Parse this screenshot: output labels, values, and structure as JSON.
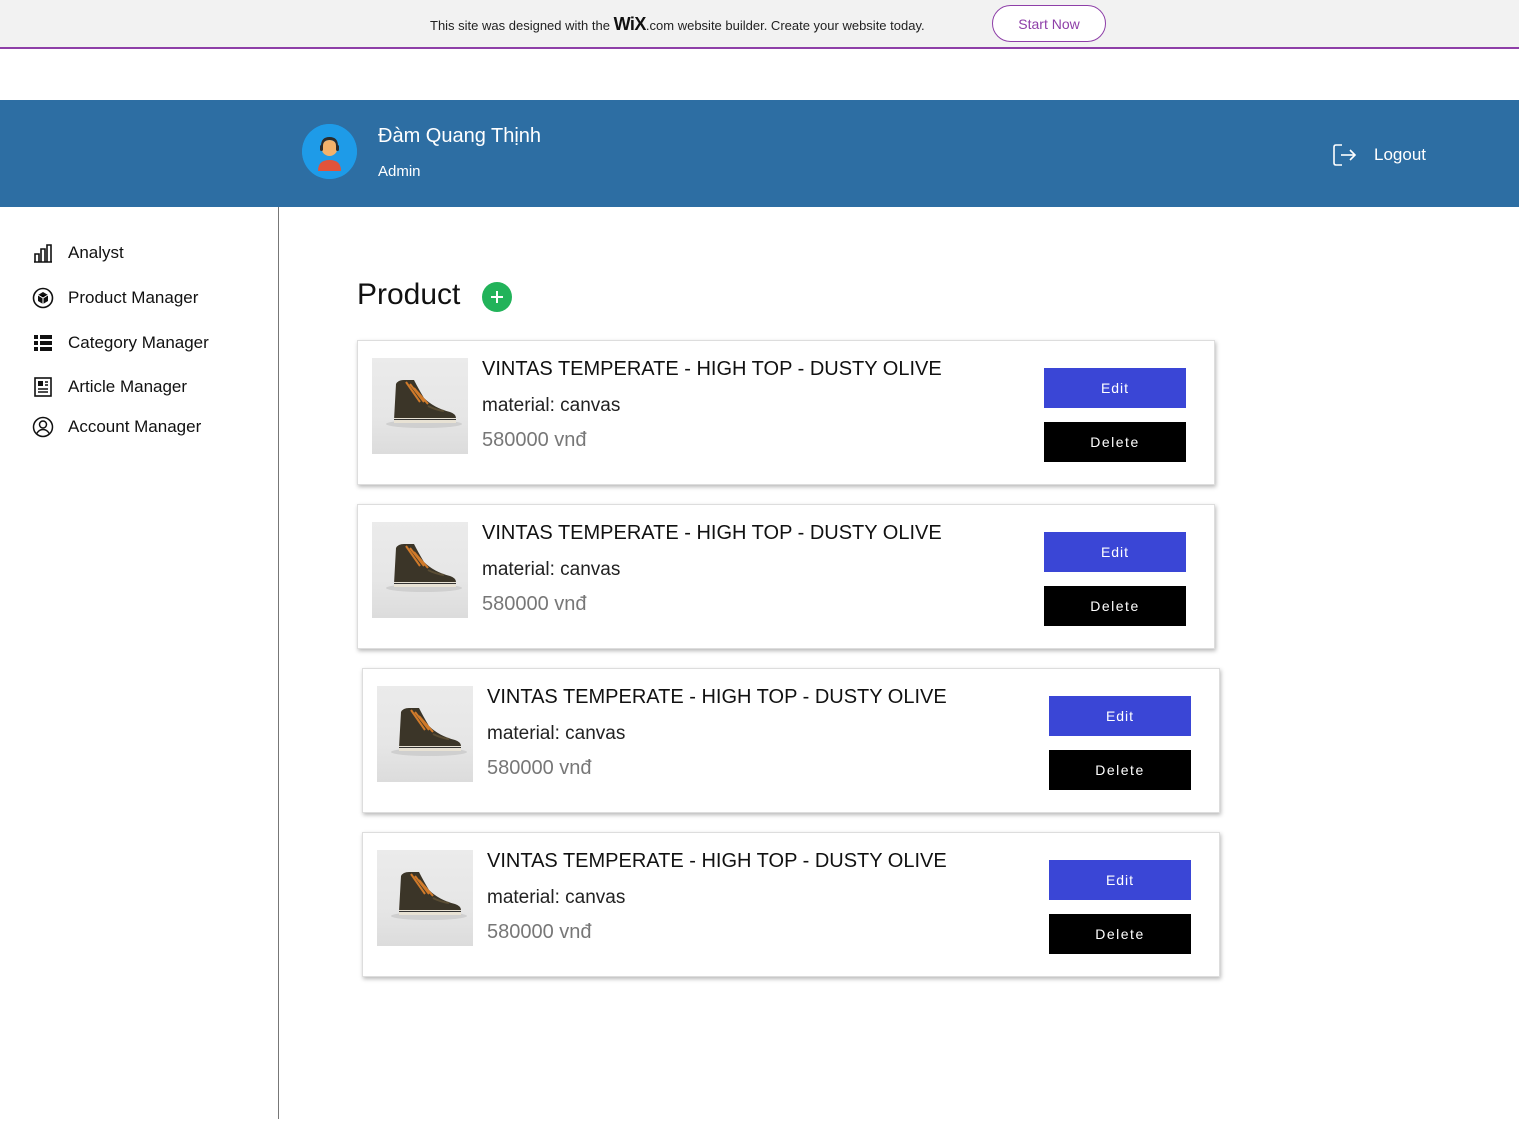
{
  "wix_banner": {
    "text_before": "This site was designed with the",
    "logo": "WiX",
    "dotcom": ".com",
    "text_after": "website builder. Create your website today.",
    "cta_label": "Start Now"
  },
  "header": {
    "user_name": "Đàm Quang Thịnh",
    "user_role": "Admin",
    "logout_label": "Logout"
  },
  "sidebar": {
    "items": [
      {
        "label": "Analyst",
        "icon": "bar-chart-icon"
      },
      {
        "label": "Product Manager",
        "icon": "cube-icon"
      },
      {
        "label": "Category Manager",
        "icon": "list-icon"
      },
      {
        "label": "Article Manager",
        "icon": "article-icon"
      },
      {
        "label": "Account Manager",
        "icon": "user-circle-icon"
      }
    ]
  },
  "main": {
    "title": "Product",
    "products": [
      {
        "name": "VINTAS TEMPERATE - HIGH TOP - DUSTY OLIVE",
        "material": "material: canvas",
        "price": "580000 vnđ",
        "edit_label": "Edit",
        "delete_label": "Delete"
      },
      {
        "name": "VINTAS TEMPERATE - HIGH TOP - DUSTY OLIVE",
        "material": "material: canvas",
        "price": "580000 vnđ",
        "edit_label": "Edit",
        "delete_label": "Delete"
      },
      {
        "name": "VINTAS TEMPERATE - HIGH TOP - DUSTY OLIVE",
        "material": "material: canvas",
        "price": "580000 vnđ",
        "edit_label": "Edit",
        "delete_label": "Delete"
      },
      {
        "name": "VINTAS TEMPERATE - HIGH TOP - DUSTY OLIVE",
        "material": "material: canvas",
        "price": "580000 vnđ",
        "edit_label": "Edit",
        "delete_label": "Delete"
      }
    ]
  },
  "colors": {
    "header_bg": "#2d6ea3",
    "edit_button": "#3a46d6",
    "delete_button": "#000000",
    "add_button": "#22b35a",
    "wix_accent": "#8e3fa8"
  }
}
